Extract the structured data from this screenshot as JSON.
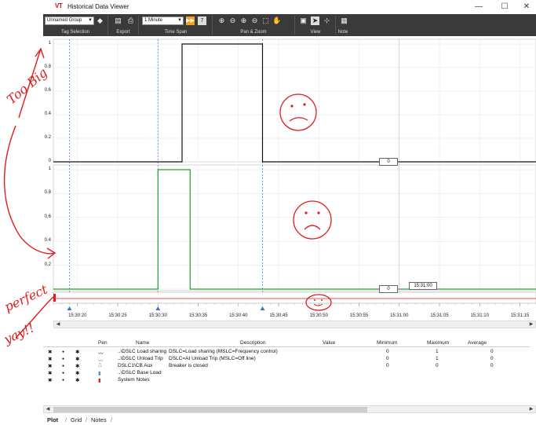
{
  "window": {
    "logo": "VT",
    "title": "Historical Data Viewer",
    "minimize_glyph": "—",
    "maximize_glyph": "☐",
    "close_glyph": "✕"
  },
  "toolbar": {
    "tag_group_value": "Unnamed Group",
    "time_span_value": "1 Minute",
    "groups": {
      "tag_selection": "Tag Selection",
      "export": "Export",
      "time_span": "Time Span",
      "pan_zoom": "Pan & Zoom",
      "view": "View",
      "note": "Note"
    }
  },
  "plot": {
    "y_ticks_top": [
      "1",
      "0.8",
      "0.6",
      "0.4",
      "0.2",
      "0"
    ],
    "y_ticks_bottom": [
      "1",
      "0.8",
      "0.6",
      "0.4",
      "0.2"
    ],
    "cursor_value_top": "0",
    "cursor_value_bottom": "0",
    "cursor_time_tooltip": "15:31:00",
    "time_ticks": [
      "15:30:20",
      "15:30:25",
      "15:30:30",
      "15:30:35",
      "15:30:40",
      "15:30:45",
      "15:30:50",
      "15:30:55",
      "15:31:00",
      "15:31:05",
      "15:31:10",
      "15:31:15"
    ],
    "colors": {
      "series1": "#111111",
      "series2": "#22a02a",
      "marker": "#2e7bd6",
      "annotation": "#e01b1b"
    }
  },
  "chart_data": {
    "type": "line",
    "series": [
      {
        "name": "..\\DSLC Load sharing",
        "points": [
          [
            "15:30:17",
            0
          ],
          [
            "15:30:33",
            0
          ],
          [
            "15:30:33",
            1
          ],
          [
            "15:30:43",
            1
          ],
          [
            "15:30:43",
            0
          ],
          [
            "15:31:17",
            0
          ]
        ]
      },
      {
        "name": "..\\DSLC Unload Trip",
        "points": [
          [
            "15:30:17",
            0
          ],
          [
            "15:30:30",
            0
          ],
          [
            "15:30:30",
            1
          ],
          [
            "15:30:34",
            1
          ],
          [
            "15:30:34",
            0
          ],
          [
            "15:31:17",
            0
          ]
        ]
      }
    ],
    "ylim": [
      0,
      1
    ],
    "xlim": [
      "15:30:17",
      "15:31:17"
    ]
  },
  "legend": {
    "headers": {
      "pen": "Pen",
      "name": "Name",
      "description": "Description",
      "value": "Value",
      "minimum": "Minimum",
      "maximum": "Maximum",
      "average": "Average"
    },
    "rows": [
      {
        "name": "..\\DSLC Load sharing",
        "description": "DSLC=Load sharing (MSLC=Frequency control)",
        "minimum": "0",
        "maximum": "1",
        "average": "0",
        "pen": "wave-black"
      },
      {
        "name": "..\\DSLC Unload Trip",
        "description": "DSLC=At Unload Trip (MSLC=Off line)",
        "minimum": "0",
        "maximum": "1",
        "average": "0",
        "pen": "wave-green"
      },
      {
        "name": "DSLC1\\CB Aux",
        "description": "Breaker is closed",
        "minimum": "0",
        "maximum": "0",
        "average": "0",
        "pen": "step-red"
      },
      {
        "name": "..\\DSLC Base Load",
        "description": "",
        "minimum": "",
        "maximum": "",
        "average": "",
        "pen": "box-blue"
      },
      {
        "name": "System Notes",
        "description": "",
        "minimum": "",
        "maximum": "",
        "average": "",
        "pen": "box-red"
      }
    ],
    "row_icons": {
      "remove": "✖",
      "visible": "●",
      "settings": "✱"
    }
  },
  "tabs": [
    "Plot",
    "Grid",
    "Notes"
  ],
  "annotations": {
    "too_big": "Too Big",
    "perfect": "perfect",
    "yay": "yay!!"
  }
}
